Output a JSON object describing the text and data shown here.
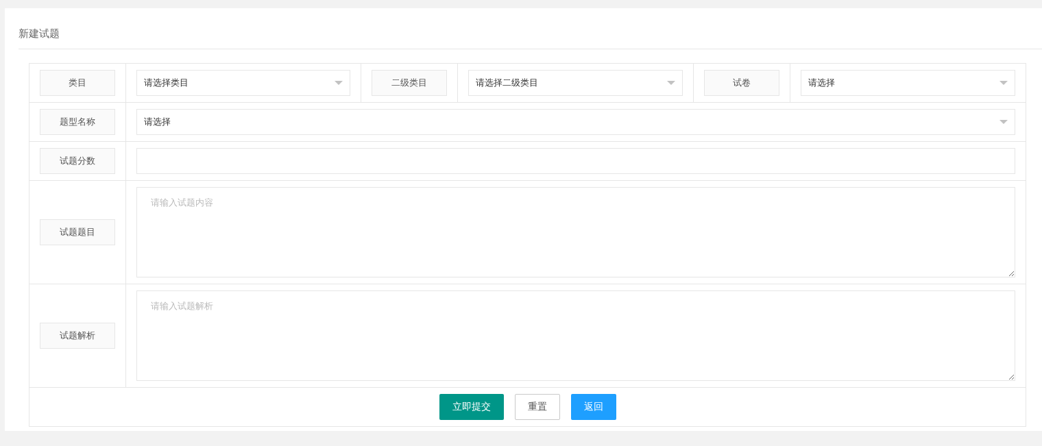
{
  "title": "新建试题",
  "rows": [
    {
      "fields": [
        {
          "label": "类目",
          "kind": "select",
          "value": "请选择类目"
        },
        {
          "label": "二级类目",
          "kind": "select",
          "value": "请选择二级类目"
        },
        {
          "label": "试卷",
          "kind": "select",
          "value": "请选择"
        }
      ]
    },
    {
      "fields": [
        {
          "label": "题型名称",
          "kind": "select",
          "value": "请选择"
        }
      ]
    },
    {
      "fields": [
        {
          "label": "试题分数",
          "kind": "input"
        }
      ]
    },
    {
      "fields": [
        {
          "label": "试题题目",
          "kind": "textarea",
          "placeholder": "请输入试题内容"
        }
      ]
    },
    {
      "fields": [
        {
          "label": "试题解析",
          "kind": "textarea",
          "placeholder": "请输入试题解析"
        }
      ]
    }
  ],
  "buttons": [
    {
      "label": "立即提交",
      "kind": "primary"
    },
    {
      "label": "重置",
      "kind": "plain"
    },
    {
      "label": "返回",
      "kind": "normal"
    }
  ]
}
